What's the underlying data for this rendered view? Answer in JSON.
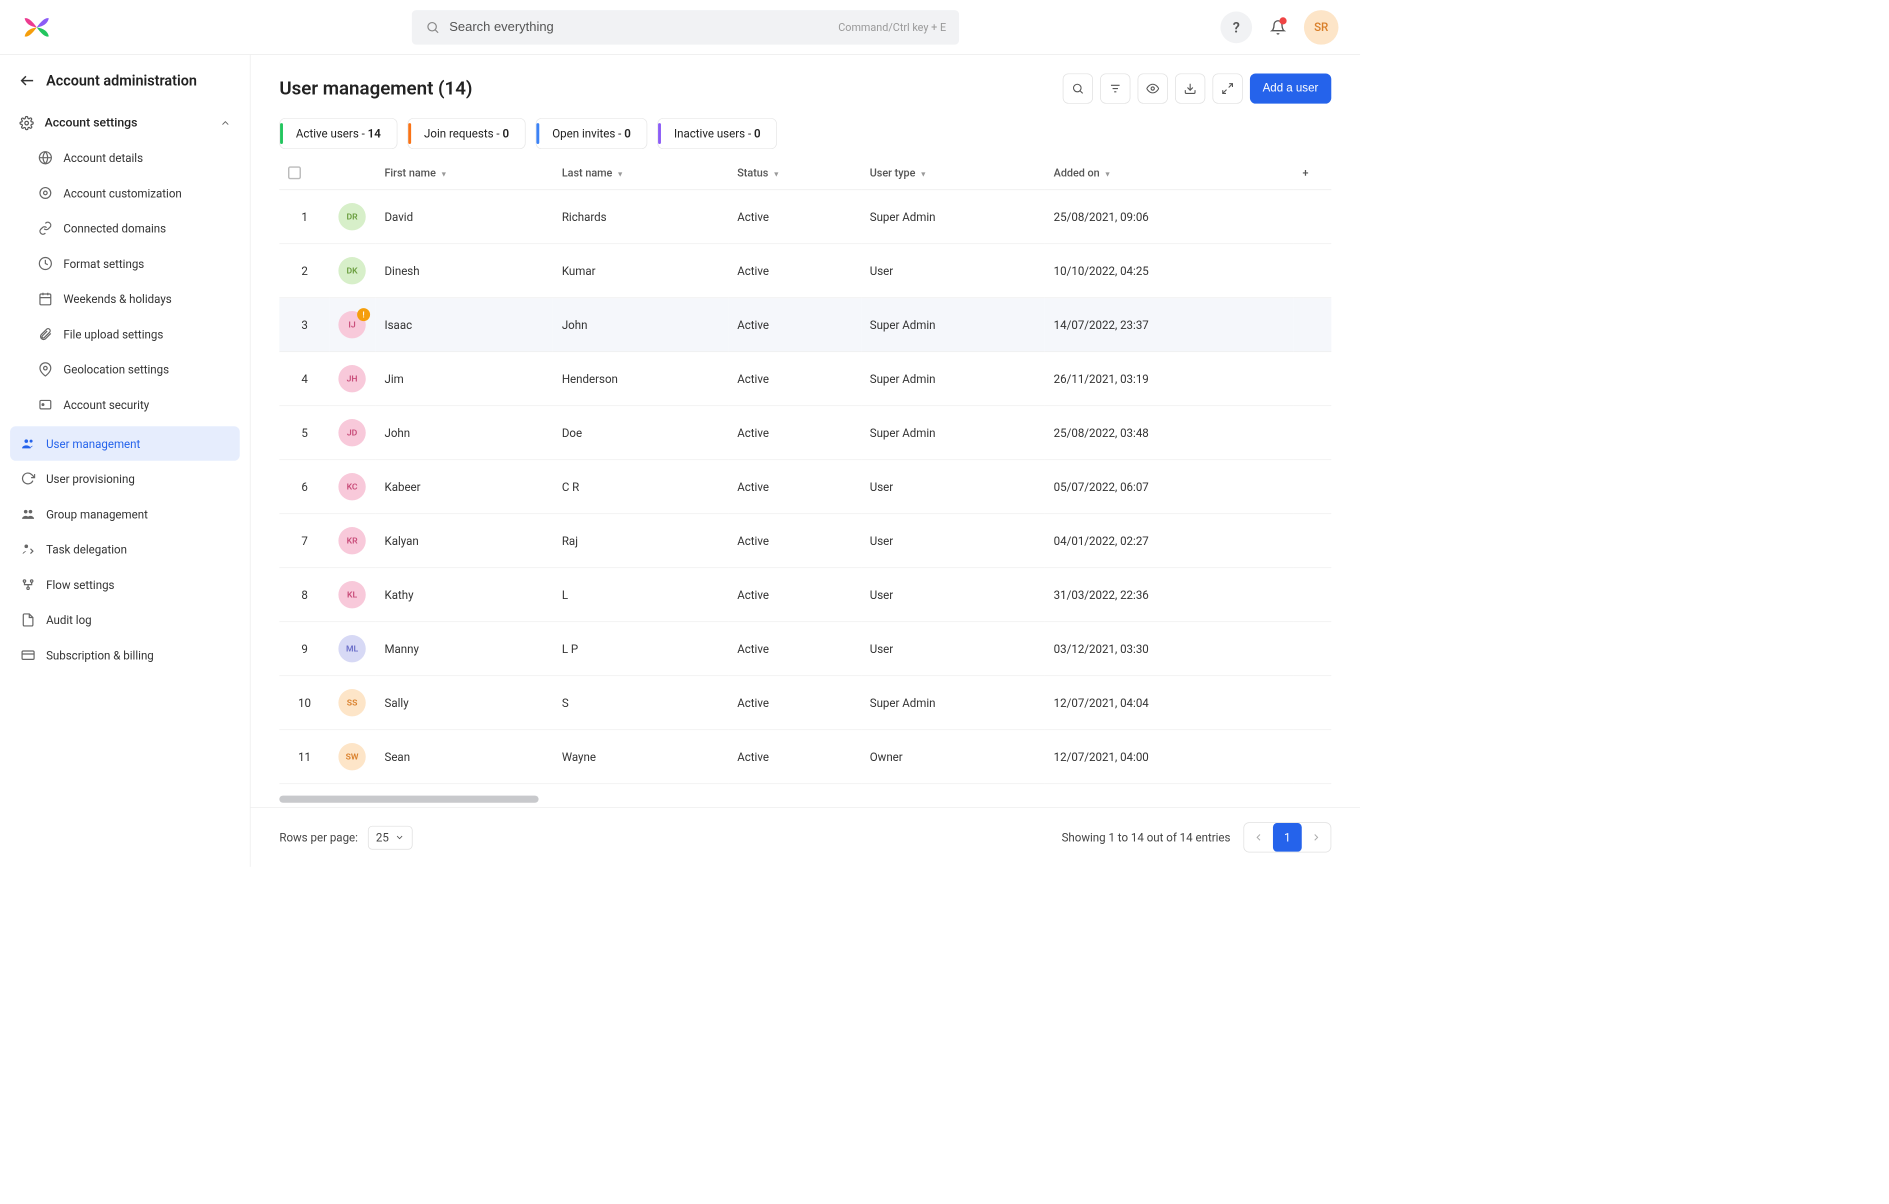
{
  "topbar": {
    "search_placeholder": "Search everything",
    "kbd_hint": "Command/Ctrl key + E",
    "avatar_initials": "SR"
  },
  "sidebar": {
    "back_title": "Account administration",
    "section_label": "Account settings",
    "children": [
      {
        "label": "Account details",
        "icon": "globe-icon"
      },
      {
        "label": "Account customization",
        "icon": "cog-star-icon"
      },
      {
        "label": "Connected domains",
        "icon": "link-icon"
      },
      {
        "label": "Format settings",
        "icon": "clock-icon"
      },
      {
        "label": "Weekends & holidays",
        "icon": "calendar-icon"
      },
      {
        "label": "File upload settings",
        "icon": "paperclip-icon"
      },
      {
        "label": "Geolocation settings",
        "icon": "pin-icon"
      },
      {
        "label": "Account security",
        "icon": "shield-icon"
      }
    ],
    "items": [
      {
        "label": "User management",
        "icon": "people-icon",
        "active": true
      },
      {
        "label": "User provisioning",
        "icon": "sync-icon"
      },
      {
        "label": "Group management",
        "icon": "group-icon"
      },
      {
        "label": "Task delegation",
        "icon": "delegate-icon"
      },
      {
        "label": "Flow settings",
        "icon": "flow-icon"
      },
      {
        "label": "Audit log",
        "icon": "page-icon"
      },
      {
        "label": "Subscription & billing",
        "icon": "card-icon"
      }
    ]
  },
  "page": {
    "title": "User management (14)",
    "primary_action": "Add a user"
  },
  "tabs": [
    {
      "label": "Active users - ",
      "count": "14",
      "color": "green"
    },
    {
      "label": "Join requests - ",
      "count": "0",
      "color": "orange"
    },
    {
      "label": "Open invites - ",
      "count": "0",
      "color": "blue"
    },
    {
      "label": "Inactive users - ",
      "count": "0",
      "color": "purple"
    }
  ],
  "table": {
    "headers": [
      "First name",
      "Last name",
      "Status",
      "User type",
      "Added on"
    ],
    "rows": [
      {
        "n": "1",
        "initials": "DR",
        "avbg": "#d7efc9",
        "avfg": "#6b9e3f",
        "first": "David",
        "last": "Richards",
        "status": "Active",
        "type": "Super Admin",
        "added": "25/08/2021, 09:06"
      },
      {
        "n": "2",
        "initials": "DK",
        "avbg": "#d7efc9",
        "avfg": "#6b9e3f",
        "first": "Dinesh",
        "last": "Kumar",
        "status": "Active",
        "type": "User",
        "added": "10/10/2022, 04:25"
      },
      {
        "n": "3",
        "initials": "IJ",
        "avbg": "#f8c9da",
        "avfg": "#c94d7a",
        "first": "Isaac",
        "last": "John",
        "status": "Active",
        "type": "Super Admin",
        "added": "14/07/2022, 23:37",
        "highlight": true,
        "badge": "!"
      },
      {
        "n": "4",
        "initials": "JH",
        "avbg": "#f8c9da",
        "avfg": "#c94d7a",
        "first": "Jim",
        "last": "Henderson",
        "status": "Active",
        "type": "Super Admin",
        "added": "26/11/2021, 03:19"
      },
      {
        "n": "5",
        "initials": "JD",
        "avbg": "#f8c9da",
        "avfg": "#c94d7a",
        "first": "John",
        "last": "Doe",
        "status": "Active",
        "type": "Super Admin",
        "added": "25/08/2022, 03:48"
      },
      {
        "n": "6",
        "initials": "KC",
        "avbg": "#f8c9da",
        "avfg": "#c94d7a",
        "first": "Kabeer",
        "last": "C R",
        "status": "Active",
        "type": "User",
        "added": "05/07/2022, 06:07"
      },
      {
        "n": "7",
        "initials": "KR",
        "avbg": "#f8c9da",
        "avfg": "#c94d7a",
        "first": "Kalyan",
        "last": "Raj",
        "status": "Active",
        "type": "User",
        "added": "04/01/2022, 02:27"
      },
      {
        "n": "8",
        "initials": "KL",
        "avbg": "#f8c9da",
        "avfg": "#c94d7a",
        "first": "Kathy",
        "last": "L",
        "status": "Active",
        "type": "User",
        "added": "31/03/2022, 22:36"
      },
      {
        "n": "9",
        "initials": "ML",
        "avbg": "#d7d9f5",
        "avfg": "#6b6fc9",
        "first": "Manny",
        "last": "L P",
        "status": "Active",
        "type": "User",
        "added": "03/12/2021, 03:30"
      },
      {
        "n": "10",
        "initials": "SS",
        "avbg": "#fde5c8",
        "avfg": "#d97f2a",
        "first": "Sally",
        "last": "S",
        "status": "Active",
        "type": "Super Admin",
        "added": "12/07/2021, 04:04"
      },
      {
        "n": "11",
        "initials": "SW",
        "avbg": "#fde5c8",
        "avfg": "#d97f2a",
        "first": "Sean",
        "last": "Wayne",
        "status": "Active",
        "type": "Owner",
        "added": "12/07/2021, 04:00"
      }
    ]
  },
  "footer": {
    "rows_label": "Rows per page:",
    "rows_value": "25",
    "showing": "Showing 1 to 14 out of 14 entries",
    "page": "1"
  }
}
